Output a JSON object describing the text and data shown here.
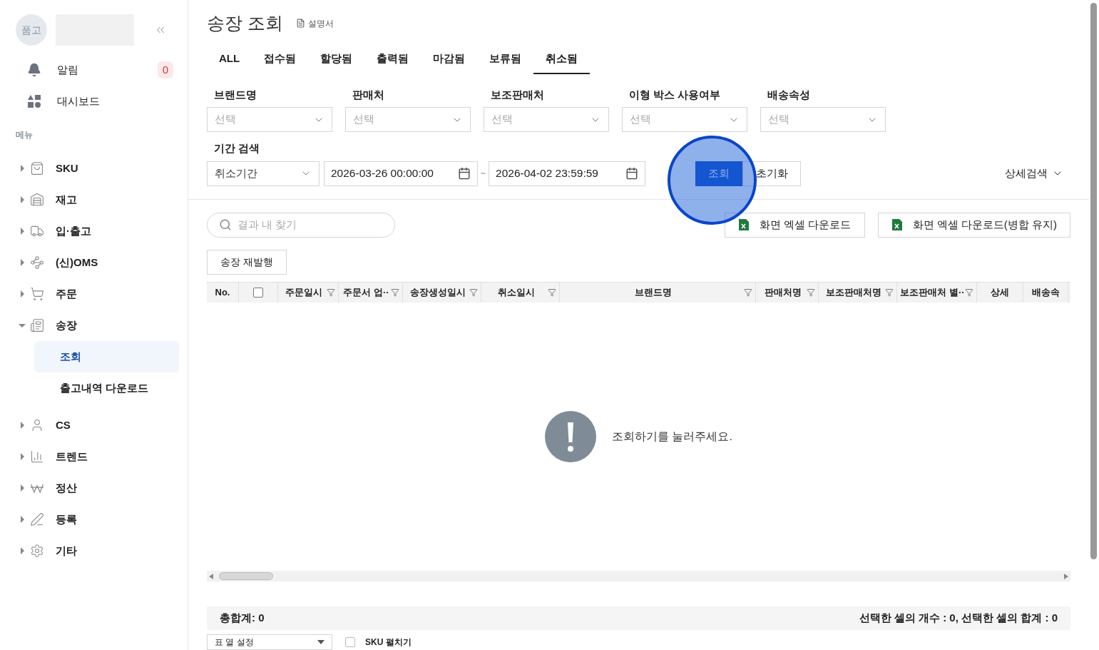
{
  "sidebar": {
    "avatar": "품고",
    "alerts": {
      "label": "알림",
      "count": "0"
    },
    "dashboard": {
      "label": "대시보드"
    },
    "section": "메뉴",
    "menu": [
      {
        "label": "SKU",
        "expanded": false
      },
      {
        "label": "재고",
        "expanded": false
      },
      {
        "label": "입·출고",
        "expanded": false
      },
      {
        "label": "(신)OMS",
        "expanded": false
      },
      {
        "label": "주문",
        "expanded": false
      },
      {
        "label": "송장",
        "expanded": true,
        "children": [
          {
            "label": "조회",
            "selected": true
          },
          {
            "label": "출고내역 다운로드",
            "selected": false
          }
        ]
      },
      {
        "label": "CS",
        "expanded": false
      },
      {
        "label": "트렌드",
        "expanded": false
      },
      {
        "label": "정산",
        "expanded": false
      },
      {
        "label": "등록",
        "expanded": false
      },
      {
        "label": "기타",
        "expanded": false
      }
    ]
  },
  "page": {
    "title": "송장 조회",
    "manual_link": "설명서"
  },
  "tabs": [
    {
      "label": "ALL",
      "selected": false
    },
    {
      "label": "접수됨",
      "selected": false
    },
    {
      "label": "할당됨",
      "selected": false
    },
    {
      "label": "출력됨",
      "selected": false
    },
    {
      "label": "마감됨",
      "selected": false
    },
    {
      "label": "보류됨",
      "selected": false
    },
    {
      "label": "취소됨",
      "selected": true
    }
  ],
  "filters": [
    {
      "label": "브랜드명",
      "placeholder": "선택"
    },
    {
      "label": "판매처",
      "placeholder": "선택"
    },
    {
      "label": "보조판매처",
      "placeholder": "선택"
    },
    {
      "label": "이형 박스 사용여부",
      "placeholder": "선택"
    },
    {
      "label": "배송속성",
      "placeholder": "선택"
    }
  ],
  "period": {
    "label": "기간 검색",
    "type": "취소기간",
    "from": "2026-03-26 00:00:00",
    "separator": "~",
    "to": "2026-04-02 23:59:59"
  },
  "actions": {
    "search": "조회",
    "reset": "초기화",
    "advanced": "상세검색"
  },
  "results": {
    "search_placeholder": "결과 내 찾기",
    "excel_buttons": [
      "화면 엑셀 다운로드",
      "화면 엑셀 다운로드(병합 유지)"
    ],
    "reissue": "송장 재발행"
  },
  "table": {
    "columns": [
      {
        "kind": "text",
        "label": "No.",
        "filter": false
      },
      {
        "kind": "checkbox",
        "checked": false
      },
      {
        "kind": "text",
        "label": "주문일시",
        "filter": true
      },
      {
        "kind": "text",
        "label": "주문서 업··",
        "filter": true
      },
      {
        "kind": "text",
        "label": "송장생성일시",
        "filter": true
      },
      {
        "kind": "text",
        "label": "취소일시",
        "filter": true
      },
      {
        "kind": "text",
        "label": "브랜드명",
        "filter": true
      },
      {
        "kind": "text",
        "label": "판매처명",
        "filter": true
      },
      {
        "kind": "text",
        "label": "보조판매처명",
        "filter": true
      },
      {
        "kind": "text",
        "label": "보조판매처 별··",
        "filter": true
      },
      {
        "kind": "text",
        "label": "상세",
        "filter": false
      },
      {
        "kind": "text",
        "label": "배송속",
        "filter": false
      }
    ],
    "empty_message": "조회하기를 눌러주세요."
  },
  "footer": {
    "total": "총합계: 0",
    "selection": "선택한 셀의 개수 : 0, 선택한 셀의 합계 : 0",
    "column_settings": "표 열 설정",
    "sku_expand": {
      "label": "SKU 펼치기",
      "checked": false
    }
  }
}
